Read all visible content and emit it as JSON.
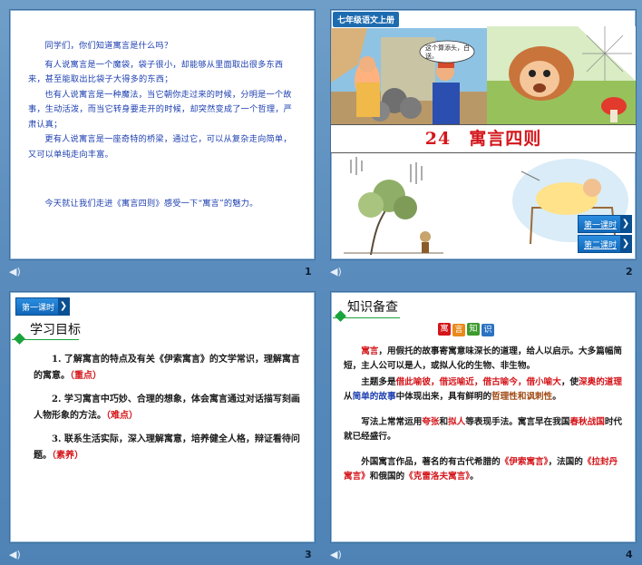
{
  "slides": [
    {
      "number": "1",
      "paragraphs": [
        "同学们，你们知道寓言是什么吗？",
        "有人说寓言是一个魔袋，袋子很小，却能够从里面取出很多东西来，甚至能取出比袋子大得多的东西；",
        "也有人说寓言是一种魔法，当它朝你走过来的时候，分明是一个故事，生动活泼，而当它转身要走开的时候，却突然变成了一个哲理，严肃认真；",
        "更有人说寓言是一座奇特的桥梁，通过它，可以从复杂走向简单，又可以单纯走向丰富。",
        "今天就让我们走进《寓言四则》感受一下“寓言”的魅力。"
      ]
    },
    {
      "number": "2",
      "grade_tag": "七年级语文上册",
      "speech_bubble": "这个算添头，白送。",
      "title": "24　寓言四则",
      "buttons": [
        "第一课时",
        "第二课时"
      ]
    },
    {
      "number": "3",
      "lesson_tag": "第一课时",
      "heading": "学习目标",
      "objectives": [
        {
          "text": "1. 了解寓言的特点及有关《伊索寓言》的文学常识，理解寓言的寓意。",
          "tag": "（重点）"
        },
        {
          "text": "2. 学习寓言中巧妙、合理的想象，体会寓言通过对话描写刻画人物形象的方法。",
          "tag": "（难点）"
        },
        {
          "text": "3. 联系生活实际，深入理解寓意，培养健全人格，辩证看待问题。",
          "tag": "（素养）"
        }
      ]
    },
    {
      "number": "4",
      "heading": "知识备查",
      "badge_chars": [
        "寓",
        "言",
        "知",
        "识"
      ],
      "p1_term": "寓言",
      "p1_rest": "，用假托的故事寄寓意味深长的道理，给人以启示。大多篇幅简短，主人公可以是人，或拟人化的生物、非生物。",
      "p2_a": "主题多是",
      "p2_hl": "借此喻彼，借远喻近，借古喻今，借小喻大",
      "p2_b": "，使",
      "p2_deep": "深奥的道理",
      "p2_c": "从",
      "p2_simple": "简单的故事",
      "p2_d": "中体现出来，具有鲜明的",
      "p2_trait": "哲理性和讽刺性",
      "p2_e": "。",
      "p3_a": "写法上常常运用",
      "p3_m1": "夸张",
      "p3_b": "和",
      "p3_m2": "拟人",
      "p3_c": "等表现手法。寓言早在我国",
      "p3_era": "春秋战国",
      "p3_d": "时代就已经盛行。",
      "p4_a": "外国寓言作品，著名的有古代希腊的",
      "p4_w1": "《伊索寓言》",
      "p4_b": "，法国的",
      "p4_w2": "《拉封丹寓言》",
      "p4_c": "和俄国的",
      "p4_w3": "《克雷洛夫寓言》",
      "p4_d": "。"
    }
  ],
  "footer_icon": "speaker-icon",
  "colors": {
    "background": "#5a8cbd",
    "accent_red": "#d4151a",
    "text_blue": "#1d3fb0",
    "green": "#19a33c"
  }
}
